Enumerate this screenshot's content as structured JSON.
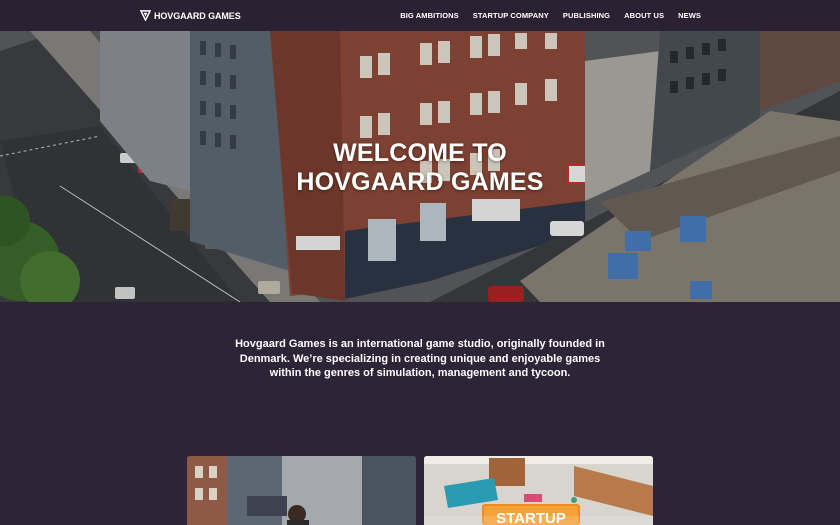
{
  "brand": {
    "logo_text": "HOVGAARD GAMES"
  },
  "nav": {
    "items": [
      {
        "label": "BIG AMBITIONS"
      },
      {
        "label": "STARTUP COMPANY"
      },
      {
        "label": "PUBLISHING"
      },
      {
        "label": "ABOUT US"
      },
      {
        "label": "NEWS"
      }
    ]
  },
  "hero": {
    "title_line1": "WELCOME TO",
    "title_line2": "HOVGAARD GAMES"
  },
  "intro": {
    "text": "Hovgaard Games is an international game studio, originally founded in Denmark. We’re specializing in creating unique and enjoyable games within the genres of simulation, management and tycoon."
  },
  "cards": [
    {
      "name": "big-ambitions"
    },
    {
      "name": "startup-company",
      "sign_text": "STARTUP"
    }
  ],
  "colors": {
    "background": "#2d2437",
    "nav": "#2a2233",
    "startup_sign": "#f08a1c"
  }
}
